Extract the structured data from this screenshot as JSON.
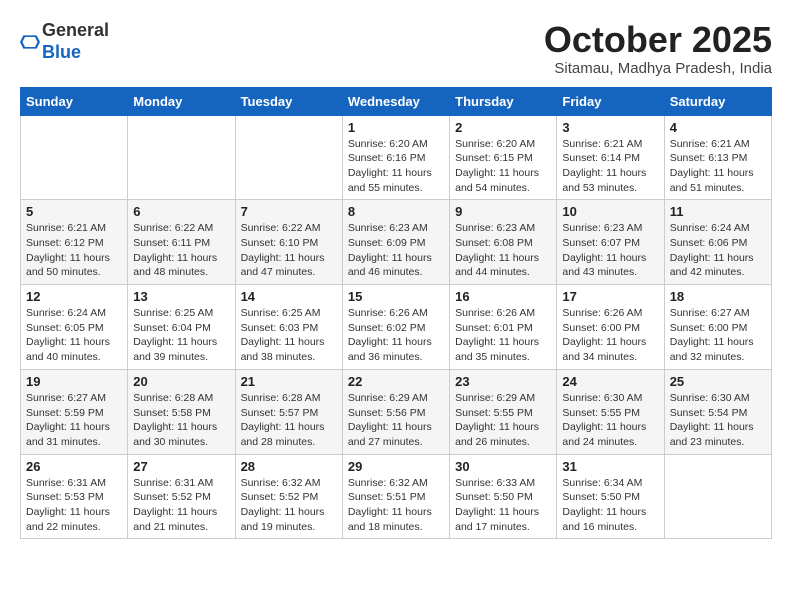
{
  "logo": {
    "general": "General",
    "blue": "Blue"
  },
  "title": "October 2025",
  "subtitle": "Sitamau, Madhya Pradesh, India",
  "weekdays": [
    "Sunday",
    "Monday",
    "Tuesday",
    "Wednesday",
    "Thursday",
    "Friday",
    "Saturday"
  ],
  "weeks": [
    [
      {
        "day": "",
        "info": ""
      },
      {
        "day": "",
        "info": ""
      },
      {
        "day": "",
        "info": ""
      },
      {
        "day": "1",
        "info": "Sunrise: 6:20 AM\nSunset: 6:16 PM\nDaylight: 11 hours\nand 55 minutes."
      },
      {
        "day": "2",
        "info": "Sunrise: 6:20 AM\nSunset: 6:15 PM\nDaylight: 11 hours\nand 54 minutes."
      },
      {
        "day": "3",
        "info": "Sunrise: 6:21 AM\nSunset: 6:14 PM\nDaylight: 11 hours\nand 53 minutes."
      },
      {
        "day": "4",
        "info": "Sunrise: 6:21 AM\nSunset: 6:13 PM\nDaylight: 11 hours\nand 51 minutes."
      }
    ],
    [
      {
        "day": "5",
        "info": "Sunrise: 6:21 AM\nSunset: 6:12 PM\nDaylight: 11 hours\nand 50 minutes."
      },
      {
        "day": "6",
        "info": "Sunrise: 6:22 AM\nSunset: 6:11 PM\nDaylight: 11 hours\nand 48 minutes."
      },
      {
        "day": "7",
        "info": "Sunrise: 6:22 AM\nSunset: 6:10 PM\nDaylight: 11 hours\nand 47 minutes."
      },
      {
        "day": "8",
        "info": "Sunrise: 6:23 AM\nSunset: 6:09 PM\nDaylight: 11 hours\nand 46 minutes."
      },
      {
        "day": "9",
        "info": "Sunrise: 6:23 AM\nSunset: 6:08 PM\nDaylight: 11 hours\nand 44 minutes."
      },
      {
        "day": "10",
        "info": "Sunrise: 6:23 AM\nSunset: 6:07 PM\nDaylight: 11 hours\nand 43 minutes."
      },
      {
        "day": "11",
        "info": "Sunrise: 6:24 AM\nSunset: 6:06 PM\nDaylight: 11 hours\nand 42 minutes."
      }
    ],
    [
      {
        "day": "12",
        "info": "Sunrise: 6:24 AM\nSunset: 6:05 PM\nDaylight: 11 hours\nand 40 minutes."
      },
      {
        "day": "13",
        "info": "Sunrise: 6:25 AM\nSunset: 6:04 PM\nDaylight: 11 hours\nand 39 minutes."
      },
      {
        "day": "14",
        "info": "Sunrise: 6:25 AM\nSunset: 6:03 PM\nDaylight: 11 hours\nand 38 minutes."
      },
      {
        "day": "15",
        "info": "Sunrise: 6:26 AM\nSunset: 6:02 PM\nDaylight: 11 hours\nand 36 minutes."
      },
      {
        "day": "16",
        "info": "Sunrise: 6:26 AM\nSunset: 6:01 PM\nDaylight: 11 hours\nand 35 minutes."
      },
      {
        "day": "17",
        "info": "Sunrise: 6:26 AM\nSunset: 6:00 PM\nDaylight: 11 hours\nand 34 minutes."
      },
      {
        "day": "18",
        "info": "Sunrise: 6:27 AM\nSunset: 6:00 PM\nDaylight: 11 hours\nand 32 minutes."
      }
    ],
    [
      {
        "day": "19",
        "info": "Sunrise: 6:27 AM\nSunset: 5:59 PM\nDaylight: 11 hours\nand 31 minutes."
      },
      {
        "day": "20",
        "info": "Sunrise: 6:28 AM\nSunset: 5:58 PM\nDaylight: 11 hours\nand 30 minutes."
      },
      {
        "day": "21",
        "info": "Sunrise: 6:28 AM\nSunset: 5:57 PM\nDaylight: 11 hours\nand 28 minutes."
      },
      {
        "day": "22",
        "info": "Sunrise: 6:29 AM\nSunset: 5:56 PM\nDaylight: 11 hours\nand 27 minutes."
      },
      {
        "day": "23",
        "info": "Sunrise: 6:29 AM\nSunset: 5:55 PM\nDaylight: 11 hours\nand 26 minutes."
      },
      {
        "day": "24",
        "info": "Sunrise: 6:30 AM\nSunset: 5:55 PM\nDaylight: 11 hours\nand 24 minutes."
      },
      {
        "day": "25",
        "info": "Sunrise: 6:30 AM\nSunset: 5:54 PM\nDaylight: 11 hours\nand 23 minutes."
      }
    ],
    [
      {
        "day": "26",
        "info": "Sunrise: 6:31 AM\nSunset: 5:53 PM\nDaylight: 11 hours\nand 22 minutes."
      },
      {
        "day": "27",
        "info": "Sunrise: 6:31 AM\nSunset: 5:52 PM\nDaylight: 11 hours\nand 21 minutes."
      },
      {
        "day": "28",
        "info": "Sunrise: 6:32 AM\nSunset: 5:52 PM\nDaylight: 11 hours\nand 19 minutes."
      },
      {
        "day": "29",
        "info": "Sunrise: 6:32 AM\nSunset: 5:51 PM\nDaylight: 11 hours\nand 18 minutes."
      },
      {
        "day": "30",
        "info": "Sunrise: 6:33 AM\nSunset: 5:50 PM\nDaylight: 11 hours\nand 17 minutes."
      },
      {
        "day": "31",
        "info": "Sunrise: 6:34 AM\nSunset: 5:50 PM\nDaylight: 11 hours\nand 16 minutes."
      },
      {
        "day": "",
        "info": ""
      }
    ]
  ]
}
